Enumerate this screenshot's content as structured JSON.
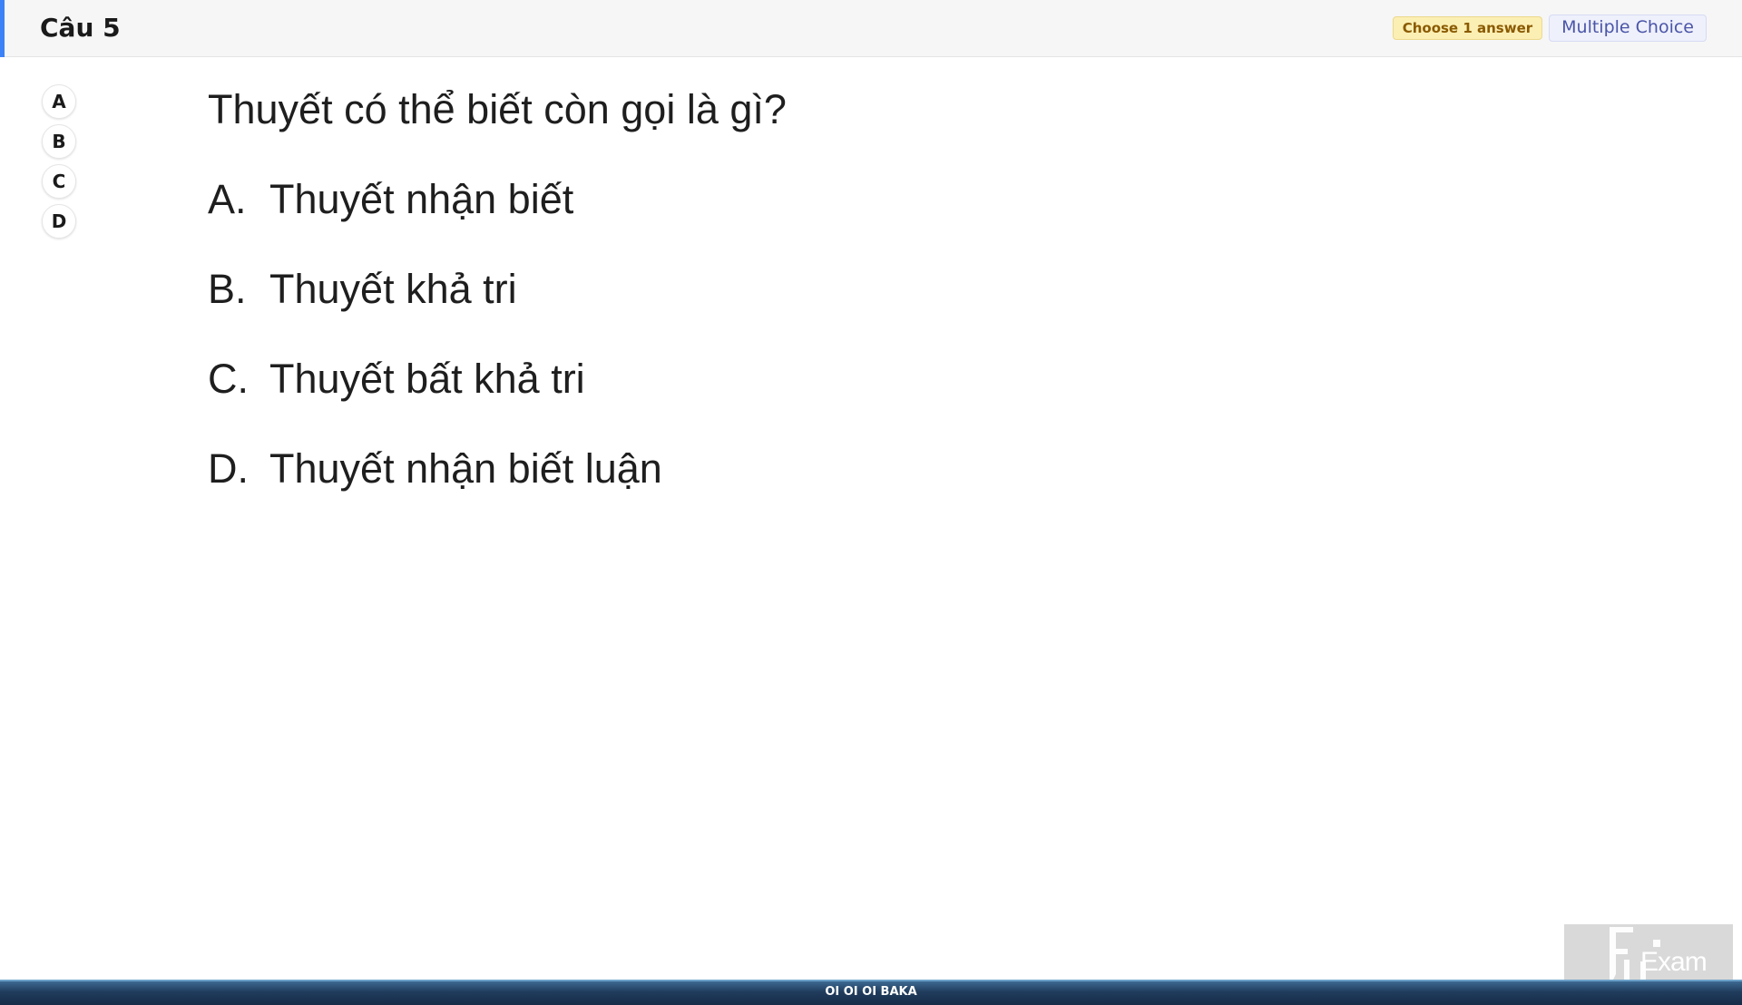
{
  "header": {
    "question_number": "Câu 5",
    "badge_choose": "Choose 1 answer",
    "badge_type": "Multiple Choice",
    "accent_color": "#3b82f6"
  },
  "answer_buttons": [
    "A",
    "B",
    "C",
    "D"
  ],
  "question": {
    "text": "Thuyết có thể biết còn gọi là gì?",
    "options": [
      {
        "letter": "A.",
        "text": "Thuyết nhận biết"
      },
      {
        "letter": "B.",
        "text": "Thuyết khả tri"
      },
      {
        "letter": "C.",
        "text": "Thuyết bất khả tri"
      },
      {
        "letter": "D.",
        "text": "Thuyết nhận biết luận"
      }
    ]
  },
  "logo": {
    "text": "Exam",
    "icon": "fu-exam-logo"
  },
  "footer": {
    "text": "OI OI OI BAKA"
  }
}
